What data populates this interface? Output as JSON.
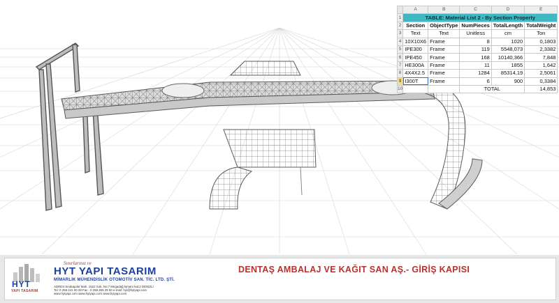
{
  "sheet": {
    "columns": [
      "A",
      "B",
      "C",
      "D",
      "E"
    ],
    "row_numbers": [
      "1",
      "2",
      "3",
      "4",
      "5",
      "6",
      "7",
      "8",
      "9",
      "10"
    ],
    "title": "TABLE:  Material List 2 - By Section Property",
    "headers": [
      "Section",
      "ObjectType",
      "NumPieces",
      "TotalLength",
      "TotalWeight"
    ],
    "units": [
      "Text",
      "Text",
      "Unitless",
      "cm",
      "Ton"
    ],
    "rows": [
      [
        "10X10X6",
        "Frame",
        "8",
        "1020",
        "0,1803"
      ],
      [
        "IPE300",
        "Frame",
        "119",
        "5548,073",
        "2,3382"
      ],
      [
        "IPE450",
        "Frame",
        "168",
        "10140,366",
        "7,848"
      ],
      [
        "HE300A",
        "Frame",
        "11",
        "1855",
        "1,642"
      ],
      [
        "4X4X2.5",
        "Frame",
        "1284",
        "85314,19",
        "2,5061"
      ],
      [
        "I300T",
        "Frame",
        "6",
        "900",
        "0,3384"
      ]
    ],
    "total_label": "TOTAL",
    "total_value": "14,853",
    "colors": {
      "title_bg": "#3fb8c4",
      "selected_row": "#f5dd8c"
    }
  },
  "footer": {
    "slogan": "Sınırlarınız ve",
    "brand": "HYT YAPI TASARIM",
    "subbrand": "MİMARLIK MÜHENDİSLİK OTOMOTİV SAN. TİC. LTD. ŞTİ.",
    "address_1": "ADRES:Sırakapılar Mah. 1522 Sok. No:7 Megadağ İşmanı kat:2  DENİZLİ",
    "address_2": "Tel: 0 258 241 00 28   Fax : 0 258 265 29 50  e-mail: hyt@hytyapi.com",
    "address_3": "www.hytyapi.com  www.hytyapi.com  www.hytyapi.com",
    "logo_text": "HYT",
    "logo_sub": "YAPI TASARIM",
    "project_title": "DENTAŞ AMBALAJ VE KAĞIT SAN AŞ.- GİRİŞ KAPISI",
    "colors": {
      "brand": "#1e3f9c",
      "accent": "#b5322f"
    }
  },
  "viewport": {
    "icon": "3d-structure-model"
  }
}
